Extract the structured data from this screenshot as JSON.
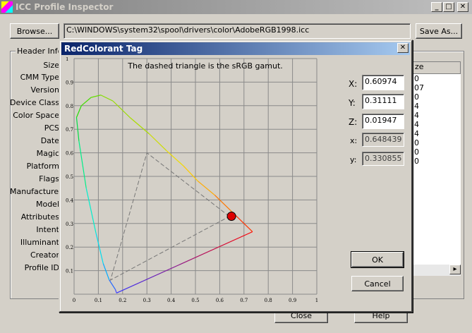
{
  "main": {
    "title": "ICC Profile Inspector",
    "browse_label": "Browse...",
    "file_path": "C:\\WINDOWS\\system32\\spool\\drivers\\color\\AdobeRGB1998.icc",
    "save_as_label": "Save As...",
    "header_group_label": "Header Info:",
    "header_fields": [
      "Size",
      "CMM Type",
      "Version",
      "Device Class",
      "Color Space",
      "PCS",
      "Date",
      "Magic",
      "Platform",
      "Flags",
      "Manufacturer",
      "Model",
      "Attributes",
      "Intent",
      "Illuminant",
      "Creator",
      "Profile ID"
    ],
    "list_column": "ze",
    "list_values": [
      "0",
      "07",
      "0",
      "4",
      "4",
      "4",
      "4",
      "0",
      "0",
      "0"
    ],
    "close_label": "Close",
    "help_label": "Help"
  },
  "dialog": {
    "title": "RedColorant Tag",
    "note": "The dashed triangle is the sRGB gamut.",
    "x_label": "X:",
    "x_value": "0.60974",
    "y_label": "Y:",
    "y_value": "0.31111",
    "z_label": "Z:",
    "z_value": "0.01947",
    "cx_label": "x:",
    "cx_value": "0.648439",
    "cy_label": "y:",
    "cy_value": "0.330855",
    "ok_label": "OK",
    "cancel_label": "Cancel"
  },
  "chart_data": {
    "type": "scatter",
    "x_ticks": [
      "0",
      "0.1",
      "0.2",
      "0.3",
      "0.4",
      "0.5",
      "0.6",
      "0.7",
      "0.8",
      "0.9",
      "1"
    ],
    "y_ticks": [
      "0",
      "0.1",
      "0.2",
      "0.3",
      "0.4",
      "0.5",
      "0.6",
      "0.7",
      "0.8",
      "0.9",
      "1"
    ],
    "xlim": [
      0,
      1
    ],
    "ylim": [
      0,
      1
    ],
    "grid": true,
    "spectral_locus": [
      [
        0.175,
        0.005
      ],
      [
        0.17,
        0.02
      ],
      [
        0.145,
        0.06
      ],
      [
        0.12,
        0.13
      ],
      [
        0.09,
        0.26
      ],
      [
        0.05,
        0.45
      ],
      [
        0.02,
        0.65
      ],
      [
        0.01,
        0.75
      ],
      [
        0.03,
        0.8
      ],
      [
        0.07,
        0.835
      ],
      [
        0.11,
        0.845
      ],
      [
        0.16,
        0.82
      ],
      [
        0.23,
        0.75
      ],
      [
        0.31,
        0.68
      ],
      [
        0.38,
        0.61
      ],
      [
        0.45,
        0.545
      ],
      [
        0.51,
        0.48
      ],
      [
        0.58,
        0.42
      ],
      [
        0.65,
        0.35
      ],
      [
        0.735,
        0.265
      ]
    ],
    "gamut_triangle": [
      [
        0.64,
        0.33
      ],
      [
        0.3,
        0.6
      ],
      [
        0.15,
        0.06
      ]
    ],
    "point": {
      "x": 0.648439,
      "y": 0.330855
    }
  },
  "colors": {
    "titlebar_active": "#0a246a",
    "point": "#dd0000"
  }
}
